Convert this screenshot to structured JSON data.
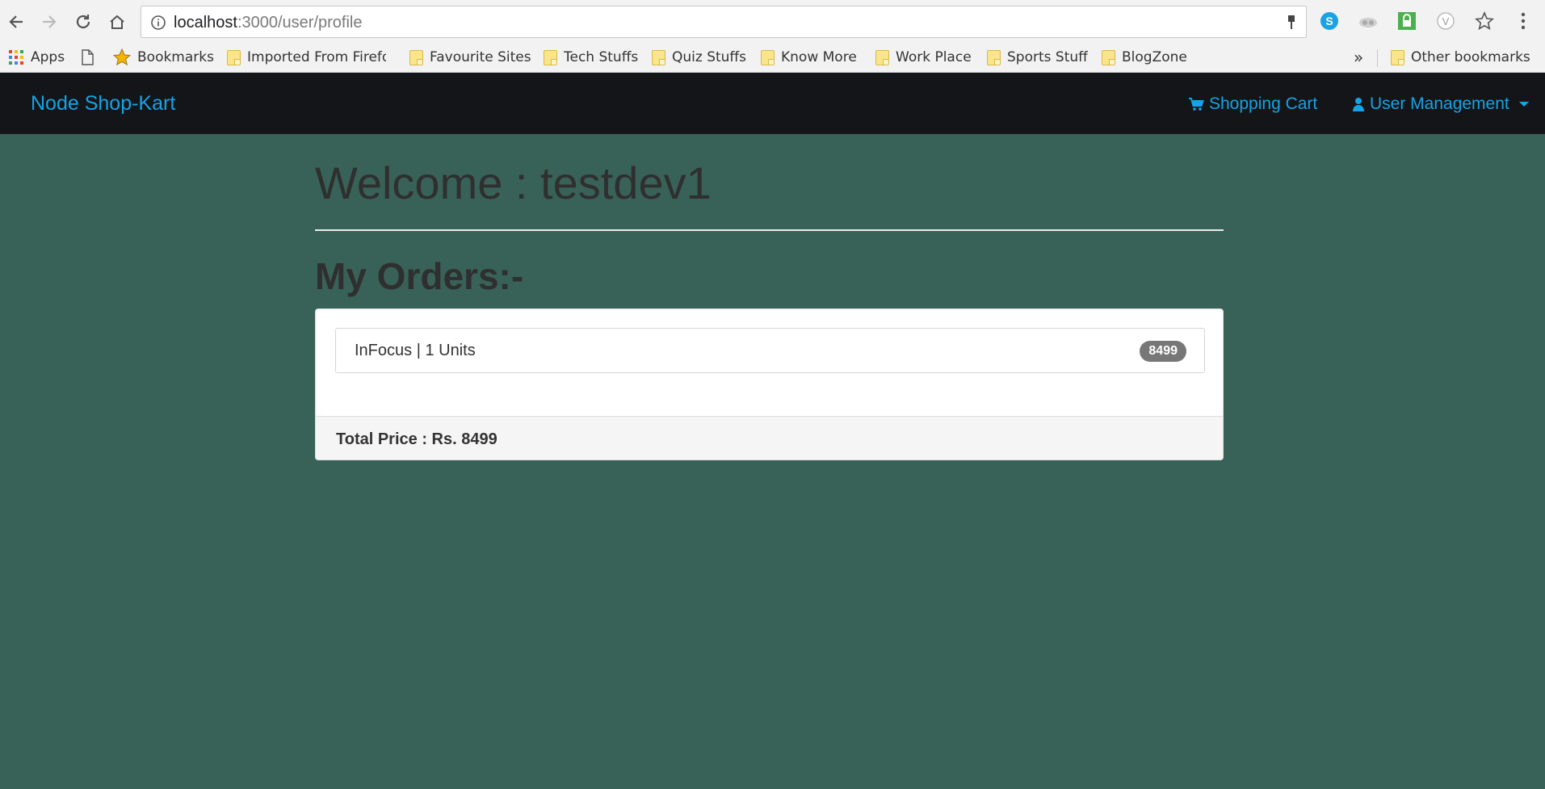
{
  "browser": {
    "url_host": "localhost",
    "url_path": ":3000/user/profile",
    "bookmarks": [
      {
        "label": "Apps",
        "icon": "apps-grid-icon"
      },
      {
        "label": "",
        "icon": "page-icon"
      },
      {
        "label": "Bookmarks",
        "icon": "star-icon"
      },
      {
        "label": "Imported From Firefox",
        "icon": "folder-icon"
      },
      {
        "label": "Favourite Sites",
        "icon": "folder-icon"
      },
      {
        "label": "Tech Stuffs",
        "icon": "folder-icon"
      },
      {
        "label": "Quiz Stuffs",
        "icon": "folder-icon"
      },
      {
        "label": "Know More",
        "icon": "folder-icon"
      },
      {
        "label": "Work Place",
        "icon": "folder-icon"
      },
      {
        "label": "Sports Stuff",
        "icon": "folder-icon"
      },
      {
        "label": "BlogZone",
        "icon": "folder-icon"
      }
    ],
    "overflow_label": "»",
    "other_bookmarks": "Other bookmarks"
  },
  "navbar": {
    "brand": "Node Shop-Kart",
    "cart": "Shopping Cart",
    "user_menu": "User Management"
  },
  "page": {
    "welcome": "Welcome : testdev1",
    "orders_title": "My Orders:-",
    "orders": [
      {
        "text": "InFocus | 1 Units",
        "price": "8499"
      }
    ],
    "total": "Total Price : Rs. 8499"
  },
  "colors": {
    "background": "#386257",
    "navbar": "#141518",
    "link": "#14a3e6",
    "badge": "#777777"
  }
}
